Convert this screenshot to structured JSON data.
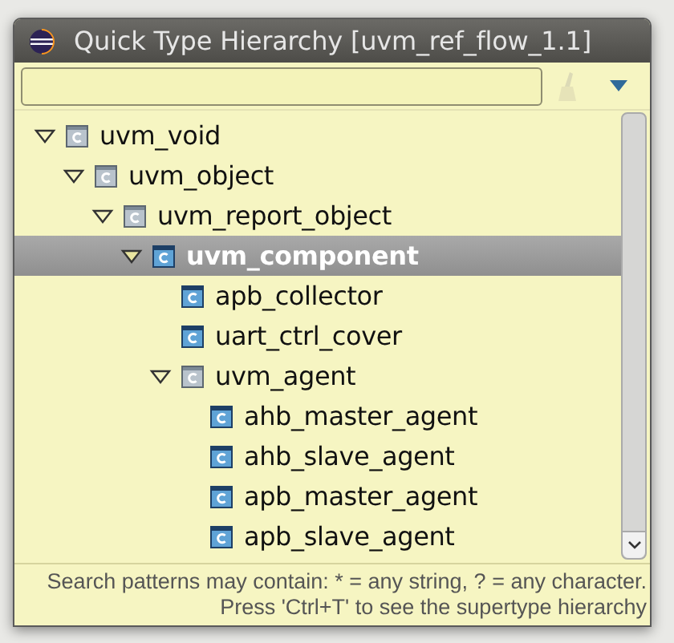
{
  "window": {
    "title": "Quick Type Hierarchy [uvm_ref_flow_1.1]"
  },
  "tree": [
    {
      "label": "uvm_void",
      "kind": "virtual",
      "expanded": true,
      "selected": false,
      "children": [
        {
          "label": "uvm_object",
          "kind": "virtual",
          "expanded": true,
          "selected": false,
          "children": [
            {
              "label": "uvm_report_object",
              "kind": "virtual",
              "expanded": true,
              "selected": false,
              "children": [
                {
                  "label": "uvm_component",
                  "kind": "class",
                  "expanded": true,
                  "selected": true,
                  "children": [
                    {
                      "label": "apb_collector",
                      "kind": "class",
                      "selected": false
                    },
                    {
                      "label": "uart_ctrl_cover",
                      "kind": "class",
                      "selected": false
                    },
                    {
                      "label": "uvm_agent",
                      "kind": "virtual",
                      "expanded": true,
                      "selected": false,
                      "children": [
                        {
                          "label": "ahb_master_agent",
                          "kind": "class",
                          "selected": false
                        },
                        {
                          "label": "ahb_slave_agent",
                          "kind": "class",
                          "selected": false
                        },
                        {
                          "label": "apb_master_agent",
                          "kind": "class",
                          "selected": false
                        },
                        {
                          "label": "apb_slave_agent",
                          "kind": "class",
                          "selected": false
                        }
                      ]
                    }
                  ]
                }
              ]
            }
          ]
        }
      ]
    }
  ],
  "footer": [
    "Search patterns may contain: * = any string, ? = any character.",
    "Press 'Ctrl+T' to see the supertype hierarchy"
  ]
}
